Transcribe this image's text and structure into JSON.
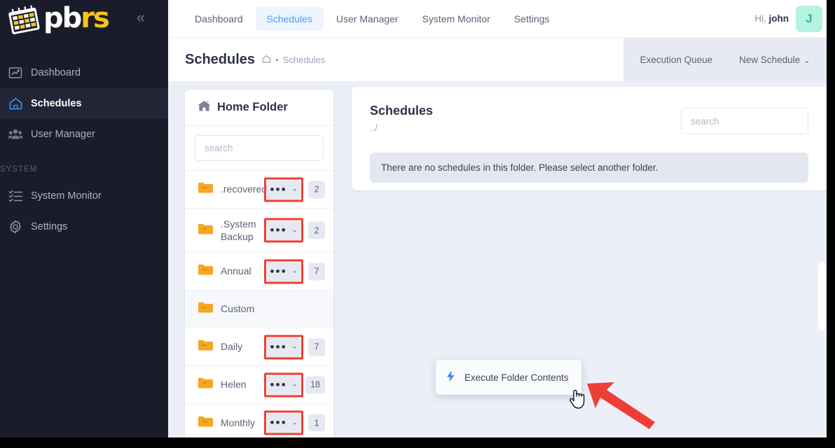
{
  "sidebar": {
    "logo": {
      "text_white": "pb",
      "text_yellow": "rs",
      "icon": "calendar-icon"
    },
    "collapse_icon": "double-chevron-left-icon",
    "items": [
      {
        "label": "Dashboard",
        "icon": "chart-line-icon",
        "active": false
      },
      {
        "label": "Schedules",
        "icon": "home-icon",
        "active": true
      },
      {
        "label": "User Manager",
        "icon": "users-icon",
        "active": false
      }
    ],
    "section_label": "SYSTEM",
    "system_items": [
      {
        "label": "System Monitor",
        "icon": "list-check-icon",
        "active": false
      },
      {
        "label": "Settings",
        "icon": "gear-icon",
        "active": false
      }
    ]
  },
  "topbar": {
    "tabs": [
      {
        "label": "Dashboard",
        "active": false
      },
      {
        "label": "Schedules",
        "active": true
      },
      {
        "label": "User Manager",
        "active": false
      },
      {
        "label": "System Monitor",
        "active": false
      },
      {
        "label": "Settings",
        "active": false
      }
    ],
    "greeting_prefix": "Hi,",
    "greeting_user": "john",
    "avatar_initial": "J"
  },
  "pagehead": {
    "title": "Schedules",
    "breadcrumb_home_icon": "home-icon",
    "breadcrumb_sep": "•",
    "breadcrumb_current": "Schedules",
    "execution_queue_label": "Execution Queue",
    "new_schedule_label": "New Schedule",
    "new_schedule_caret": "⌄"
  },
  "folder_panel": {
    "header_title": "Home Folder",
    "header_icon": "home-folder-icon",
    "search_placeholder": "search",
    "search_value": "",
    "dots_glyph": "●●●",
    "caret_glyph": "⌄",
    "rows": [
      {
        "name": ".recovered",
        "count": "2",
        "highlighted": true,
        "hover": false
      },
      {
        "name": ".System Backup",
        "count": "2",
        "highlighted": true,
        "hover": false
      },
      {
        "name": "Annual",
        "count": "7",
        "highlighted": true,
        "hover": false
      },
      {
        "name": "Custom",
        "count": "",
        "highlighted": false,
        "hover": true
      },
      {
        "name": "Daily",
        "count": "7",
        "highlighted": true,
        "hover": false
      },
      {
        "name": "Helen",
        "count": "18",
        "highlighted": true,
        "hover": false
      },
      {
        "name": "Monthly",
        "count": "1",
        "highlighted": true,
        "hover": false
      }
    ]
  },
  "dropdown": {
    "items": [
      {
        "label": "Execute Folder Contents",
        "icon": "lightning-bolt-icon"
      }
    ]
  },
  "schedules_panel": {
    "title": "Schedules",
    "path": "../",
    "search_placeholder": "search",
    "search_value": "",
    "empty_message": "There are no schedules in this folder. Please select another folder."
  },
  "annotations": {
    "highlight_color": "#ef3e36",
    "arrow_color": "#ef3e36",
    "cursor_icon": "pointing-hand-cursor-icon",
    "arrow_icon": "arrow-pointer-icon"
  },
  "colors": {
    "sidebar_bg": "#1b1c2b",
    "page_bg": "#eceff7",
    "accent_blue": "#4a9cf5",
    "folder_orange": "#f5a623",
    "avatar_bg": "#b5f2e0"
  }
}
